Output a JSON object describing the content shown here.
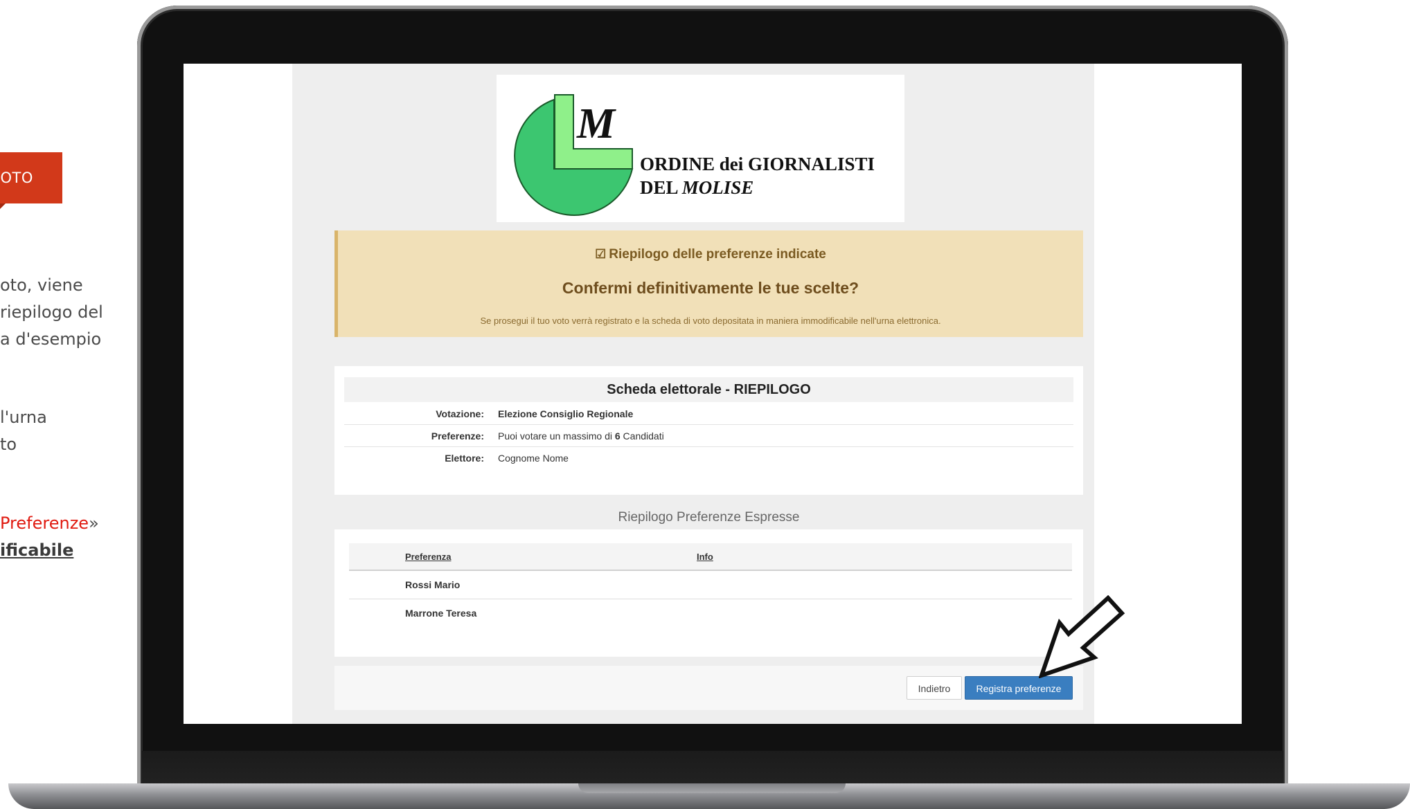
{
  "slide": {
    "badge": "VOTO",
    "para1": [
      "oto, viene",
      "riepilogo del",
      "a d'esempio"
    ],
    "para2": [
      "l'urna",
      "to"
    ],
    "para3_red": "Preferenze",
    "para3_tail": "»",
    "para3_bold": "ificabile"
  },
  "logo": {
    "letter": "M",
    "line1": "ORDINE dei GIORNALISTI",
    "line2_prefix": "DEL ",
    "line2_italic": "MOLISE",
    "colors": {
      "pie": "#3cc670",
      "L": "#8ff08a"
    }
  },
  "alert": {
    "icon": "check-square-icon",
    "heading": "Riepilogo delle preferenze indicate",
    "question": "Confermi definitivamente le tue scelte?",
    "note": "Se prosegui il tuo voto verrà registrato e la scheda di voto depositata in maniera immodificabile nell'urna elettronica."
  },
  "summary": {
    "title": "Scheda elettorale - RIEPILOGO",
    "rows": [
      {
        "label": "Votazione:",
        "value": "Elezione Consiglio Regionale"
      },
      {
        "label": "Preferenze:",
        "value_prefix": "Puoi votare un massimo di ",
        "value_count": "6",
        "value_suffix": " Candidati"
      },
      {
        "label": "Elettore:",
        "value": "Cognome Nome"
      }
    ]
  },
  "preferences": {
    "section_title": "Riepilogo Preferenze Espresse",
    "columns": [
      "Preferenza",
      "Info"
    ],
    "rows": [
      "Rossi Mario",
      "Marrone Teresa"
    ]
  },
  "buttons": {
    "back": "Indietro",
    "save": "Registra preferenze",
    "save_color": "#3a7ec0"
  }
}
